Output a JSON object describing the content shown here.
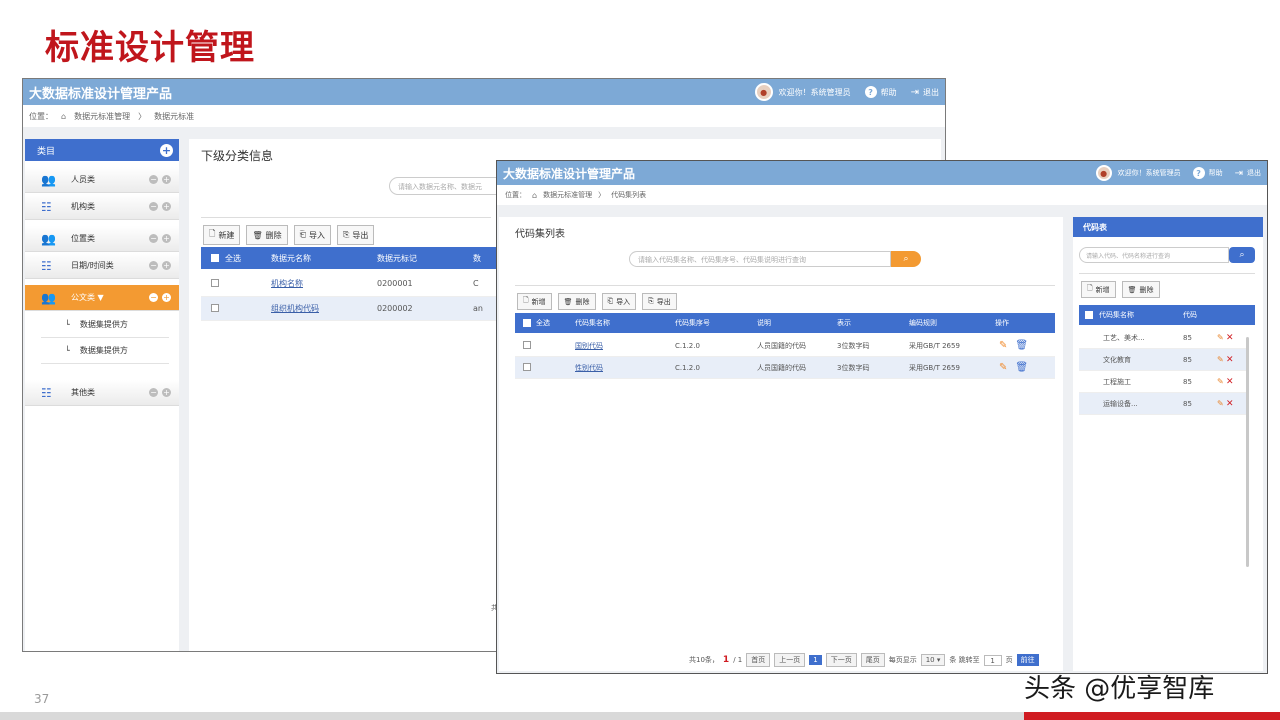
{
  "slide": {
    "title": "标准设计管理",
    "page_number": "37",
    "watermark": "头条 @优享智库"
  },
  "app1": {
    "title": "大数据标准设计管理产品",
    "user_greeting": "欢迎你！系统管理员",
    "help": "帮助",
    "logout": "退出",
    "breadcrumb": {
      "label": "位置：",
      "level1": "数据元标准管理",
      "sep": "〉",
      "level2": "数据元标准"
    },
    "sidebar": {
      "header": "类目",
      "categories": [
        {
          "label": "人员类",
          "icon": "people-icon"
        },
        {
          "label": "机构类",
          "icon": "tree-icon"
        },
        {
          "label": "位置类",
          "icon": "people-icon"
        },
        {
          "label": "日期/时间类",
          "icon": "tree-icon"
        },
        {
          "label": "公文类",
          "icon": "people-icon",
          "active": true
        },
        {
          "label": "其他类",
          "icon": "tree-icon"
        }
      ],
      "subitems": [
        "数据集提供方",
        "数据集提供方"
      ]
    },
    "main": {
      "title": "下级分类信息",
      "search_placeholder": "请输入数据元名称、数据元",
      "toolbar": {
        "new": "新建",
        "delete": "删除",
        "import": "导入",
        "export": "导出"
      },
      "table": {
        "headers": [
          "全选",
          "数据元名称",
          "数据元标记",
          "数"
        ],
        "rows": [
          {
            "name": "机构名称",
            "code": "0200001",
            "extra": "C"
          },
          {
            "name": "组织机构代码",
            "code": "0200002",
            "extra": "an"
          }
        ]
      },
      "footer_fragment": "共"
    }
  },
  "app2": {
    "title": "大数据标准设计管理产品",
    "user_greeting": "欢迎你！系统管理员",
    "help": "帮助",
    "logout": "退出",
    "breadcrumb": {
      "label": "位置：",
      "level1": "数据元标准管理",
      "sep": "〉",
      "level2": "代码集列表"
    },
    "main": {
      "title": "代码集列表",
      "search_placeholder": "请输入代码集名称、代码集序号、代码集说明进行查询",
      "toolbar": {
        "new": "新增",
        "delete": "删除",
        "import": "导入",
        "export": "导出"
      },
      "table": {
        "headers": [
          "全选",
          "代码集名称",
          "代码集序号",
          "说明",
          "表示",
          "编码规则",
          "操作"
        ],
        "rows": [
          {
            "name": "国别代码",
            "seq": "C.1.2.0",
            "desc": "人员国籍的代码",
            "repr": "3位数字码",
            "rule": "采用GB/T 2659"
          },
          {
            "name": "性别代码",
            "seq": "C.1.2.0",
            "desc": "人员国籍的代码",
            "repr": "3位数字码",
            "rule": "采用GB/T 2659"
          }
        ]
      },
      "pager": {
        "total_prefix": "共10条，",
        "current": "1",
        "total_pages": "/ 1",
        "first": "首页",
        "prev": "上一页",
        "page": "1",
        "next": "下一页",
        "last": "尾页",
        "per_page_label": "每页显示",
        "per_page": "10 ▾",
        "jump_label": "条 跳转至",
        "jump_value": "1",
        "page_unit": "页",
        "go": "前往"
      }
    },
    "right": {
      "header": "代码表",
      "search_placeholder": "请输入代码、代码名称进行查询",
      "toolbar": {
        "new": "新增",
        "delete": "删除"
      },
      "headers": [
        "代码集名称",
        "代码"
      ],
      "rows": [
        {
          "name": "工艺、美术...",
          "code": "85"
        },
        {
          "name": "文化教育",
          "code": "85"
        },
        {
          "name": "工程施工",
          "code": "85"
        },
        {
          "name": "运输设备...",
          "code": "85"
        }
      ]
    }
  },
  "colors": {
    "brand_red": "#c0161c",
    "header_blue": "#7da9d6",
    "accent_blue": "#3f6fcd",
    "active_orange": "#f39a32"
  }
}
